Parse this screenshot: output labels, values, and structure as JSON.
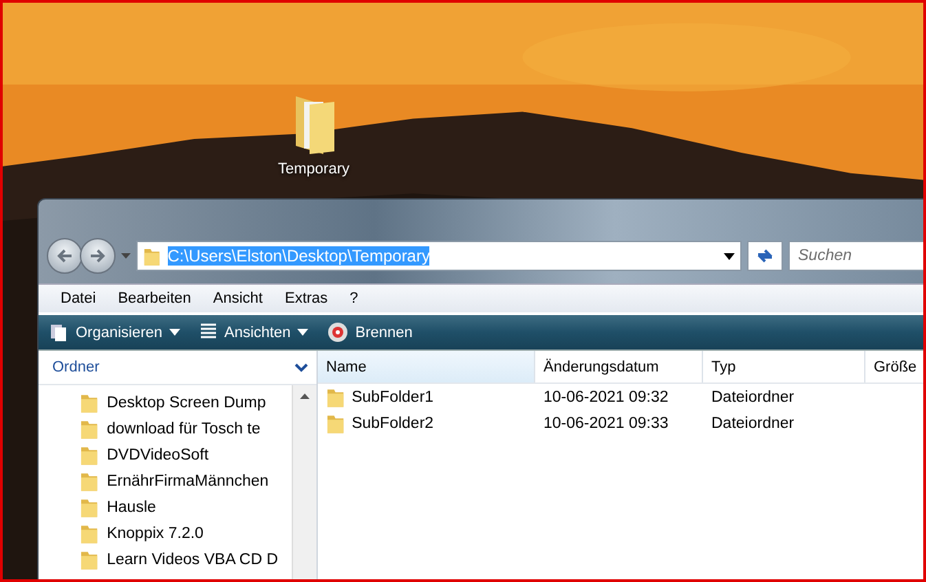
{
  "desktop": {
    "icons": [
      {
        "label": "Temporary"
      }
    ]
  },
  "window": {
    "address": {
      "value": "C:\\Users\\Elston\\Desktop\\Temporary",
      "selected": true
    },
    "search": {
      "placeholder": "Suchen"
    },
    "menu": [
      "Datei",
      "Bearbeiten",
      "Ansicht",
      "Extras",
      "?"
    ],
    "toolbar": [
      {
        "kind": "organize",
        "label": "Organisieren",
        "dropdown": true
      },
      {
        "kind": "views",
        "label": "Ansichten",
        "dropdown": true
      },
      {
        "kind": "burn",
        "label": "Brennen",
        "dropdown": false
      }
    ],
    "folders_pane": {
      "title": "Ordner",
      "items": [
        {
          "label": "Desktop Screen Dump"
        },
        {
          "label": "download für Tosch te"
        },
        {
          "label": "DVDVideoSoft"
        },
        {
          "label": "ErnährFirmaMännchen"
        },
        {
          "label": "Hausle"
        },
        {
          "label": "Knoppix 7.2.0"
        },
        {
          "label": "Learn Videos VBA CD D"
        }
      ]
    },
    "table": {
      "columns": [
        "Name",
        "Änderungsdatum",
        "Typ",
        "Größe"
      ],
      "rows": [
        {
          "name": "SubFolder1",
          "modified": "10-06-2021 09:32",
          "type": "Dateiordner"
        },
        {
          "name": "SubFolder2",
          "modified": "10-06-2021 09:33",
          "type": "Dateiordner"
        }
      ]
    }
  }
}
